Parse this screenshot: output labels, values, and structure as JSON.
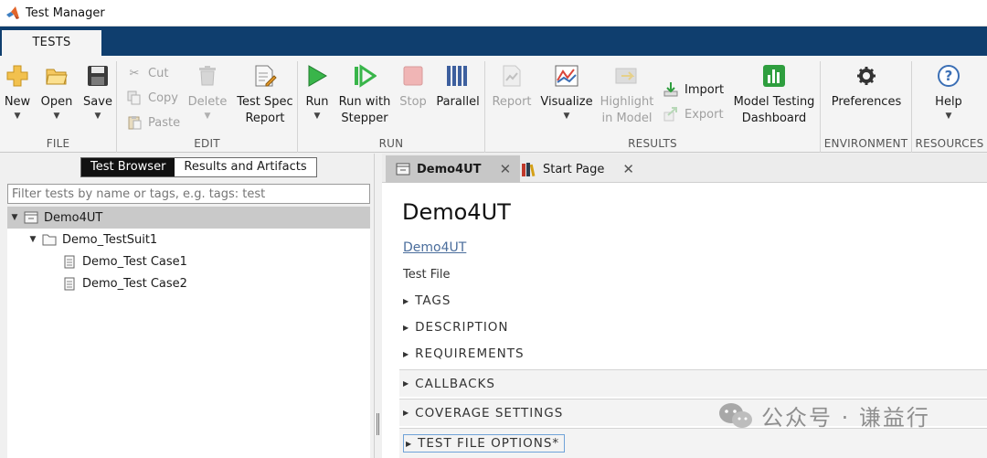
{
  "window": {
    "title": "Test Manager"
  },
  "tabs": [
    {
      "label": "TESTS"
    }
  ],
  "ribbon": {
    "file": {
      "label": "FILE",
      "buttons": [
        {
          "label": "New"
        },
        {
          "label": "Open"
        },
        {
          "label": "Save"
        }
      ]
    },
    "edit": {
      "label": "EDIT",
      "cut": "Cut",
      "copy": "Copy",
      "paste": "Paste",
      "delete": "Delete",
      "test_spec_1": "Test Spec",
      "test_spec_2": "Report"
    },
    "run": {
      "label": "RUN",
      "run": "Run",
      "run_stepper_1": "Run with",
      "run_stepper_2": "Stepper",
      "stop": "Stop",
      "parallel": "Parallel"
    },
    "results": {
      "label": "RESULTS",
      "report": "Report",
      "visualize": "Visualize",
      "highlight_1": "Highlight",
      "highlight_2": "in Model",
      "import": "Import",
      "export": "Export",
      "mtd_1": "Model Testing",
      "mtd_2": "Dashboard"
    },
    "environment": {
      "label": "ENVIRONMENT",
      "preferences": "Preferences"
    },
    "resources": {
      "label": "RESOURCES",
      "help": "Help"
    }
  },
  "left": {
    "segments": [
      {
        "label": "Test Browser",
        "active": true
      },
      {
        "label": "Results and Artifacts",
        "active": false
      }
    ],
    "filter_placeholder": "Filter tests by name or tags, e.g. tags: test",
    "tree": [
      {
        "label": "Demo4UT"
      },
      {
        "label": "Demo_TestSuit1"
      },
      {
        "label": "Demo_Test Case1"
      },
      {
        "label": "Demo_Test Case2"
      }
    ]
  },
  "doc_tabs": [
    {
      "label": "Demo4UT"
    },
    {
      "label": "Start Page"
    }
  ],
  "content": {
    "title": "Demo4UT",
    "link": "Demo4UT",
    "file_type": "Test File",
    "sections": [
      {
        "label": "TAGS"
      },
      {
        "label": "DESCRIPTION"
      },
      {
        "label": "REQUIREMENTS"
      },
      {
        "label": "CALLBACKS"
      },
      {
        "label": "COVERAGE SETTINGS"
      },
      {
        "label": "TEST FILE OPTIONS*"
      }
    ]
  },
  "watermark": {
    "text": "公众号 · 谦益行"
  },
  "colors": {
    "tabstrip": "#0f3e6e",
    "run_green": "#2e9e3e",
    "help_blue": "#3b6fb5",
    "link": "#4a6d9c"
  }
}
